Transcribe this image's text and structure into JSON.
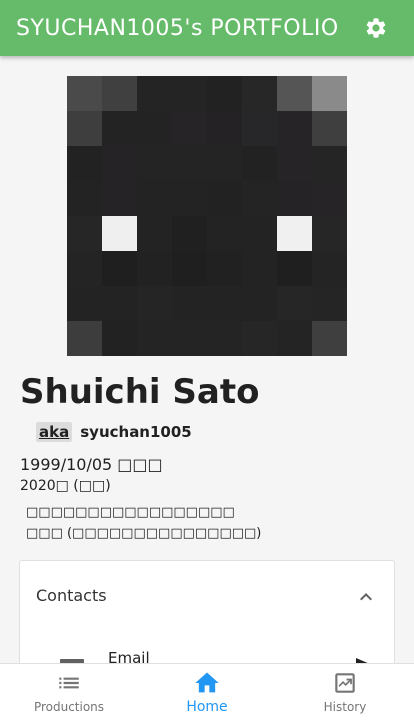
{
  "appbar": {
    "title": "SYUCHAN1005's PORTFOLIO",
    "icon": "gear-icon"
  },
  "avatar": {
    "cells": [
      "#4a4a4a",
      "#404040",
      "#242424",
      "#242424",
      "#222222",
      "#272727",
      "#555555",
      "#8a8a8a",
      "#3e3e3e",
      "#232323",
      "#232323",
      "#262426",
      "#242224",
      "#272629",
      "#262426",
      "#3f3f3f",
      "#222222",
      "#252325",
      "#242424",
      "#242424",
      "#242424",
      "#222222",
      "#262426",
      "#252525",
      "#232323",
      "#252325",
      "#232323",
      "#232323",
      "#222222",
      "#242424",
      "#252325",
      "#262426",
      "#262626",
      "#efefef",
      "#232323",
      "#202020",
      "#232323",
      "#232323",
      "#f0f0f0",
      "#262626",
      "#242424",
      "#1f1f1f",
      "#222222",
      "#1f1f1f",
      "#212121",
      "#232323",
      "#1f1f1f",
      "#242424",
      "#232323",
      "#232323",
      "#252525",
      "#232323",
      "#232323",
      "#232323",
      "#262626",
      "#252525",
      "#3d3d3d",
      "#222222",
      "#242424",
      "#242424",
      "#242424",
      "#262626",
      "#242424",
      "#3f3f3f"
    ]
  },
  "profile": {
    "name": "Shuichi Sato",
    "aka_label": "aka",
    "handle": "syuchan1005",
    "birth": "1999/10/05 □□□",
    "since": "2020□ (□□)",
    "bio_line1": "□□□□□□□□□□□□□□□□□",
    "bio_line2": "□□□ (□□□□□□□□□□□□□□□)"
  },
  "contacts": {
    "title": "Contacts",
    "email_label": "Email"
  },
  "bottom_nav": {
    "items": [
      {
        "label": "Productions",
        "icon": "list-icon",
        "active": false
      },
      {
        "label": "Home",
        "icon": "home-icon",
        "active": true
      },
      {
        "label": "History",
        "icon": "trending-up-icon",
        "active": false
      }
    ],
    "accent": "#2196f3"
  },
  "colors": {
    "appbar": "#66bb6a"
  }
}
